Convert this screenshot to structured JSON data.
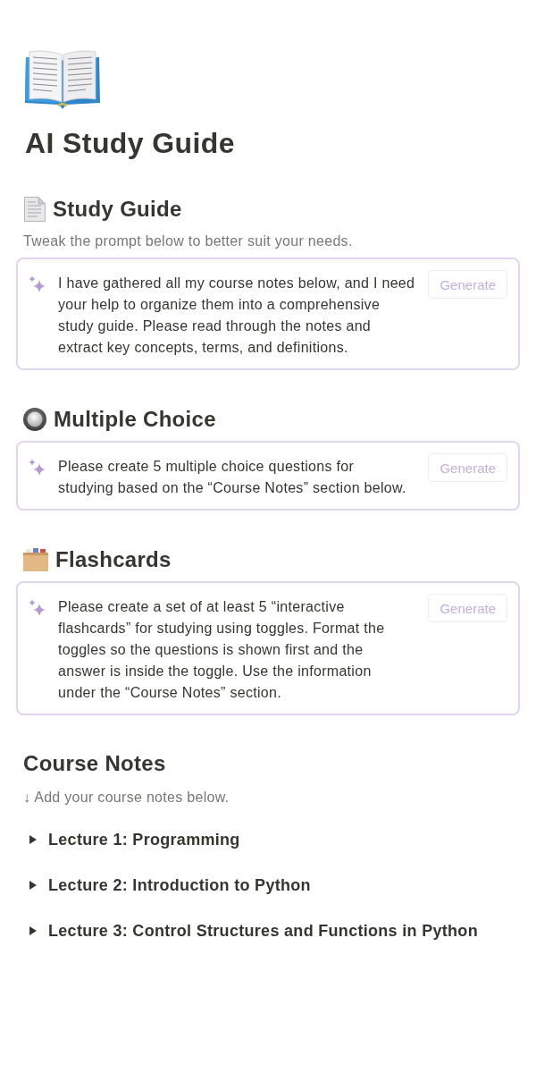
{
  "page": {
    "title": "AI Study Guide"
  },
  "sections": [
    {
      "kind": "guide",
      "heading": "Study Guide",
      "description": "Tweak the prompt below to better suit your needs.",
      "prompt": "I have gathered all my course notes below, and I need\nyour help to organize them into a comprehensive\nstudy guide. Please read through the notes and\nextract key concepts, terms, and definitions.",
      "button": "Generate"
    },
    {
      "kind": "quiz",
      "heading": "Multiple Choice",
      "prompt": "Please create 5 multiple choice questions for\nstudying based on the “Course Notes” section below.",
      "button": "Generate"
    },
    {
      "kind": "flashcards",
      "heading": "Flashcards",
      "prompt": "Please create a set of at least 5 “interactive\nflashcards” for studying using toggles. Format the\ntoggles so the questions is shown first and the\nanswer is inside the toggle. Use the information\nunder the “Course Notes” section.",
      "button": "Generate"
    }
  ],
  "course_notes": {
    "heading": "Course Notes",
    "hint": "↓ Add your course notes below.",
    "toggles": [
      {
        "label": "Lecture 1: Programming",
        "expanded": false
      },
      {
        "label": "Lecture 2: Introduction to Python",
        "expanded": false
      },
      {
        "label": "Lecture 3: Control Structures and Functions in Python",
        "expanded": false
      }
    ]
  }
}
